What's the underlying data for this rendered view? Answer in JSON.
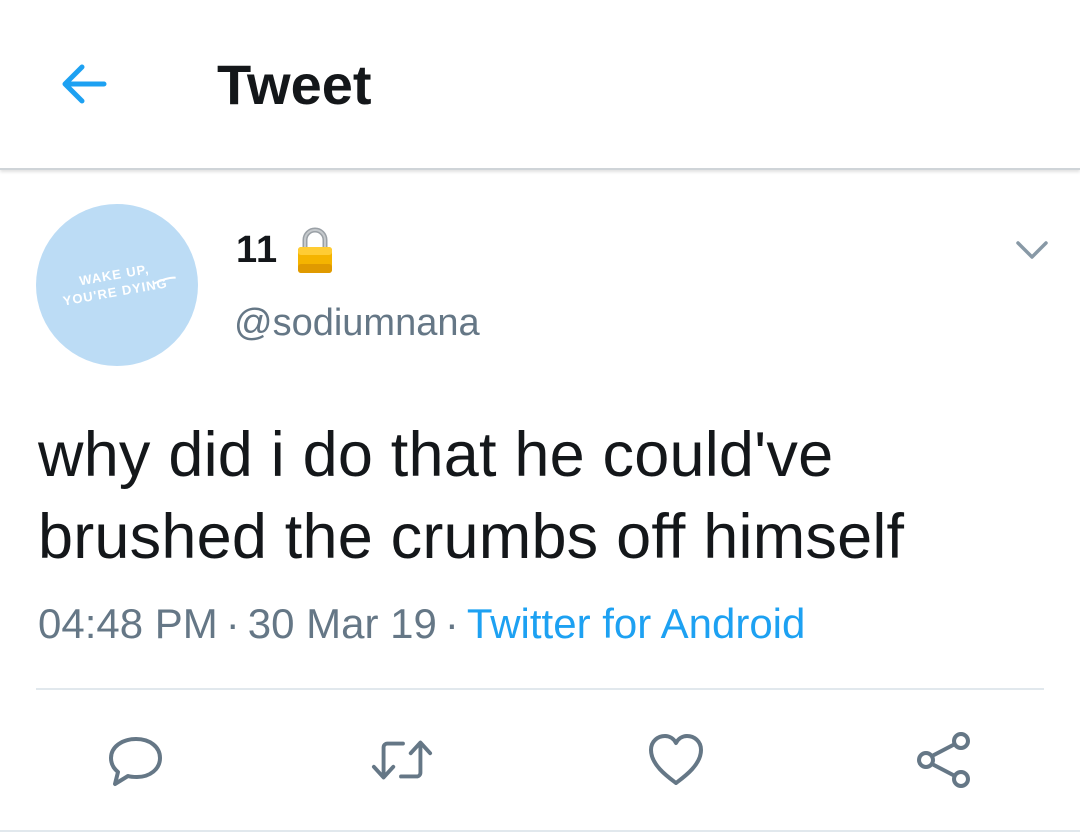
{
  "header": {
    "title": "Tweet",
    "back_icon": "arrow-left-icon",
    "accent_color": "#1da1f2"
  },
  "author": {
    "display_name": "11",
    "handle": "@sodiumnana",
    "protected_icon": "lock-icon",
    "avatar": {
      "text_line1": "WAKE UP,",
      "text_line2": "YOU'RE DYING",
      "background": "#bcdcf5"
    }
  },
  "tweet": {
    "text": "why did i do that he could've brushed the crumbs off himself",
    "time": "04:48 PM",
    "separator": "·",
    "date": "30 Mar 19",
    "source": "Twitter for Android"
  },
  "actions": [
    {
      "name": "reply",
      "icon": "reply-icon"
    },
    {
      "name": "retweet",
      "icon": "retweet-icon"
    },
    {
      "name": "like",
      "icon": "heart-icon"
    },
    {
      "name": "share",
      "icon": "share-icon"
    }
  ],
  "colors": {
    "text_primary": "#14171a",
    "text_secondary": "#657786",
    "link": "#1da1f2",
    "icon_gray": "#657786"
  }
}
